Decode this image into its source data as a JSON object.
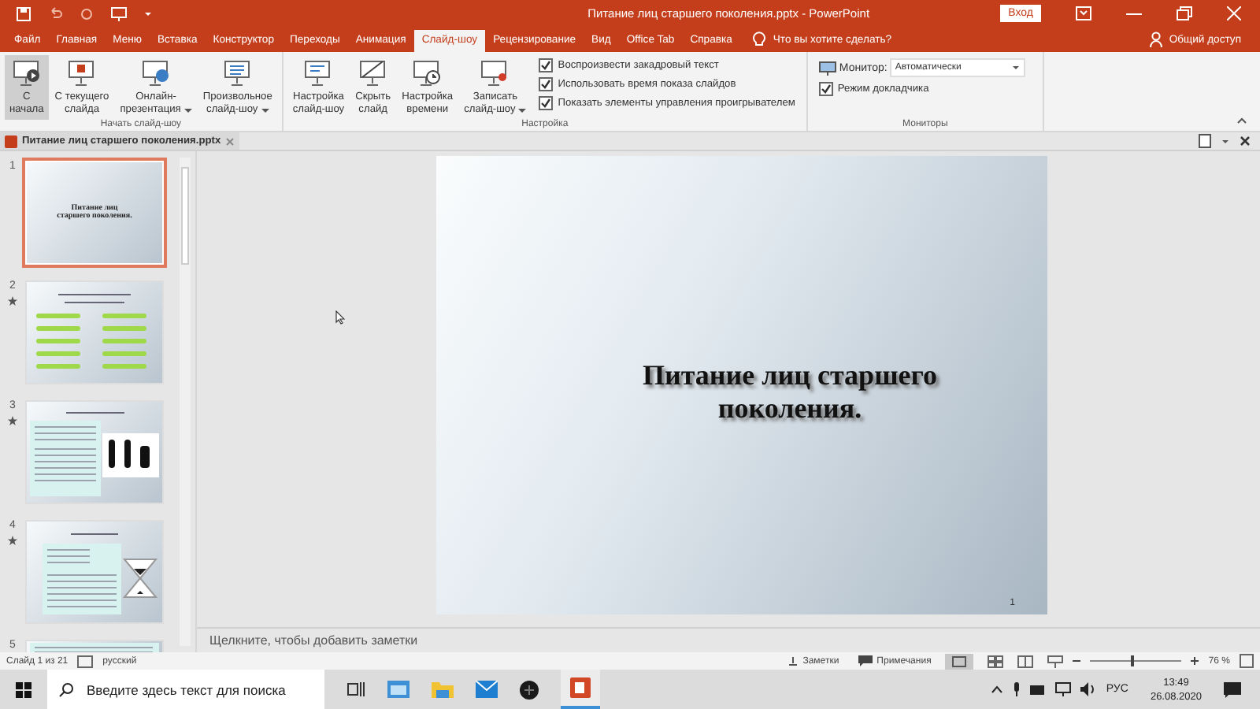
{
  "window": {
    "title": "Питание лиц старшего поколения.pptx - PowerPoint",
    "sign_in": "Вход"
  },
  "tabs": [
    {
      "label": "Файл",
      "selected": false
    },
    {
      "label": "Главная",
      "selected": false
    },
    {
      "label": "Меню",
      "selected": false
    },
    {
      "label": "Вставка",
      "selected": false
    },
    {
      "label": "Конструктор",
      "selected": false
    },
    {
      "label": "Переходы",
      "selected": false
    },
    {
      "label": "Анимация",
      "selected": false
    },
    {
      "label": "Слайд-шоу",
      "selected": true
    },
    {
      "label": "Рецензирование",
      "selected": false
    },
    {
      "label": "Вид",
      "selected": false
    },
    {
      "label": "Office Tab",
      "selected": false
    },
    {
      "label": "Справка",
      "selected": false
    }
  ],
  "tell_me": {
    "placeholder": "Что вы хотите сделать?"
  },
  "share": "Общий доступ",
  "ribbon": {
    "groups": [
      {
        "label": "Начать слайд-шоу",
        "buttons": [
          {
            "kind": "play",
            "lines": [
              "С",
              "начала"
            ],
            "selected": true,
            "dropdown": false
          },
          {
            "kind": "step",
            "lines": [
              "С текущего",
              "слайда"
            ],
            "selected": false,
            "dropdown": false
          },
          {
            "kind": "globe",
            "lines": [
              "Онлайн-",
              "презентация"
            ],
            "selected": false,
            "dropdown": true
          },
          {
            "kind": "list",
            "lines": [
              "Произвольное",
              "слайд-шоу"
            ],
            "selected": false,
            "dropdown": true
          }
        ]
      },
      {
        "label": "Настройка",
        "buttons": [
          {
            "kind": "gear",
            "lines": [
              "Настройка",
              "слайд-шоу"
            ],
            "selected": false,
            "dropdown": false
          },
          {
            "kind": "hide",
            "lines": [
              "Скрыть",
              "слайд"
            ],
            "selected": false,
            "dropdown": false
          },
          {
            "kind": "clock",
            "lines": [
              "Настройка",
              "времени"
            ],
            "selected": false,
            "dropdown": false
          },
          {
            "kind": "record",
            "lines": [
              "Записать",
              "слайд-шоу"
            ],
            "selected": false,
            "dropdown": true
          }
        ],
        "checks": [
          {
            "label": "Воспроизвести закадровый текст",
            "checked": true
          },
          {
            "label": "Использовать время показа слайдов",
            "checked": true
          },
          {
            "label": "Показать элементы управления проигрывателем",
            "checked": true
          }
        ]
      },
      {
        "label": "Мониторы",
        "monitor": {
          "label": "Монитор:",
          "value": "Автоматически"
        },
        "checks": [
          {
            "label": "Режим докладчика",
            "checked": true
          }
        ]
      }
    ]
  },
  "document_tab": "Питание лиц старшего поколения.pptx",
  "slides": [
    {
      "number": "1",
      "selected": true,
      "animated": false,
      "kind": "title",
      "title": "Питание лиц старшего поколения."
    },
    {
      "number": "2",
      "selected": false,
      "animated": true,
      "kind": "bars"
    },
    {
      "number": "3",
      "selected": false,
      "animated": true,
      "kind": "figures"
    },
    {
      "number": "4",
      "selected": false,
      "animated": true,
      "kind": "hourglass"
    },
    {
      "number": "5",
      "selected": false,
      "animated": false,
      "kind": "text"
    }
  ],
  "slide": {
    "title": "Питание лиц старшего поколения.",
    "number": "1"
  },
  "notes": {
    "placeholder": "Щелкните, чтобы добавить заметки"
  },
  "status_bar": {
    "slide": "Слайд 1 из 21",
    "language": "русский",
    "notes": "Заметки",
    "comments": "Примечания",
    "zoom": {
      "level": 0.45,
      "reading": "76 %"
    }
  },
  "taskbar": {
    "search": {
      "placeholder": "Введите здесь текст для поиска"
    },
    "language": "РУС",
    "time": "13:49",
    "date": "26.08.2020"
  }
}
